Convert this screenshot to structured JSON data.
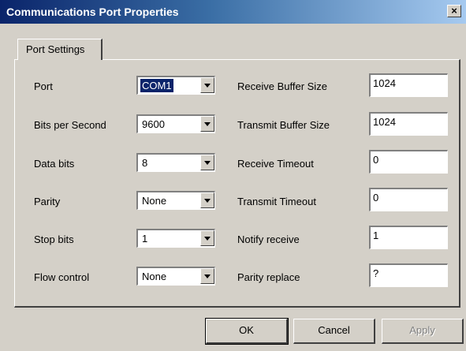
{
  "window": {
    "title": "Communications Port Properties",
    "close_glyph": "×"
  },
  "tab": {
    "label": "Port Settings"
  },
  "left_fields": [
    {
      "label": "Port",
      "value": "COM1"
    },
    {
      "label": "Bits per Second",
      "value": "9600"
    },
    {
      "label": "Data bits",
      "value": "8"
    },
    {
      "label": "Parity",
      "value": "None"
    },
    {
      "label": "Stop bits",
      "value": "1"
    },
    {
      "label": "Flow control",
      "value": "None"
    }
  ],
  "right_fields": [
    {
      "label": "Receive Buffer Size",
      "value": "1024"
    },
    {
      "label": "Transmit Buffer Size",
      "value": "1024"
    },
    {
      "label": "Receive Timeout",
      "value": "0"
    },
    {
      "label": "Transmit Timeout",
      "value": "0"
    },
    {
      "label": "Notify receive",
      "value": "1"
    },
    {
      "label": "Parity replace",
      "value": "?"
    }
  ],
  "buttons": {
    "ok": "OK",
    "cancel": "Cancel",
    "apply": "Apply"
  }
}
